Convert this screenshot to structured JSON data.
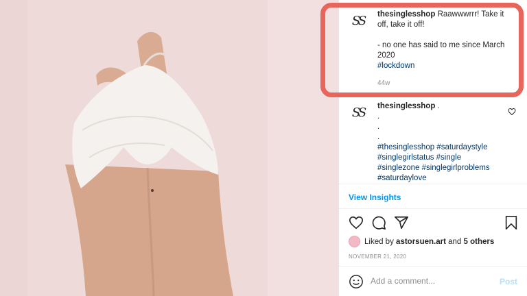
{
  "photo": {
    "alt": ""
  },
  "comments": [
    {
      "avatar": "SS",
      "username": "thesinglesshop",
      "text": "Raawwwrrr! Take it off, take it off!",
      "lines": [
        "- no one has said to me since March",
        "2020"
      ],
      "tags": [
        "#lockdown"
      ],
      "time": "44w"
    },
    {
      "avatar": "SS",
      "username": "thesinglesshop",
      "text": ".",
      "dots": [
        ".",
        ".",
        "."
      ],
      "tags": [
        "#thesinglesshop #saturdaystyle",
        "#singlegirlstatus #single",
        "#singlezone #singlegirlproblems",
        "#saturdaylove"
      ]
    }
  ],
  "insights_label": "View Insights",
  "likes": {
    "prefix": "Liked by",
    "user": "astorsuen.art",
    "and": "and",
    "others": "5 others"
  },
  "date": "NOVEMBER 21, 2020",
  "add_comment": {
    "placeholder": "Add a comment...",
    "post_label": "Post"
  },
  "colors": {
    "highlight": "#e8655b",
    "link": "#0095f6",
    "hashtag": "#00376b"
  },
  "icons": [
    "heart-icon",
    "comment-icon",
    "share-icon",
    "bookmark-icon",
    "smile-icon"
  ]
}
